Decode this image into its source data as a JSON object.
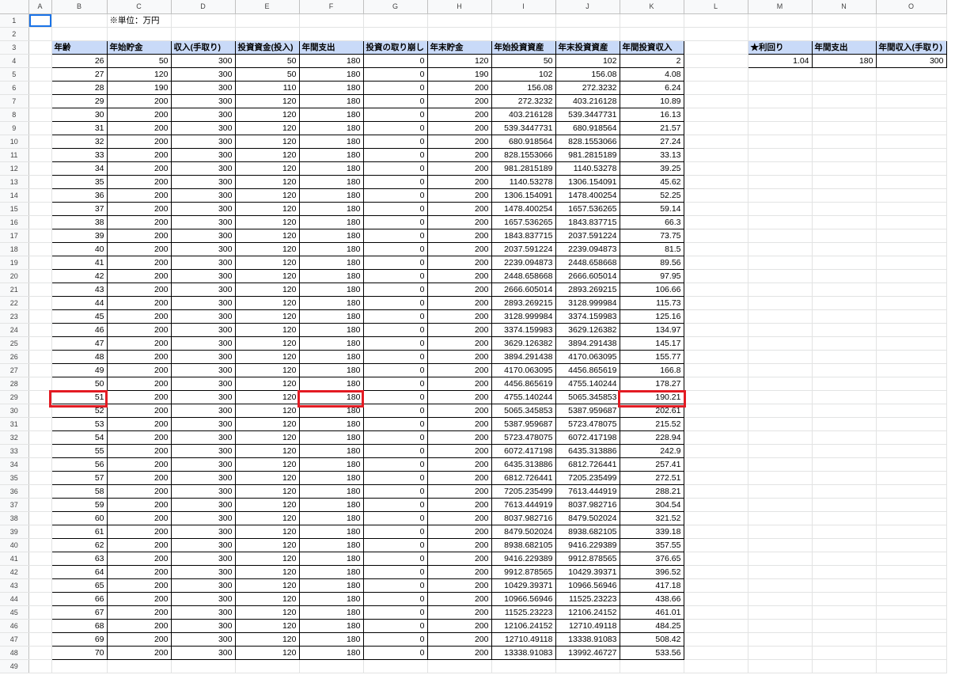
{
  "columns": [
    "",
    "A",
    "B",
    "C",
    "D",
    "E",
    "F",
    "G",
    "H",
    "I",
    "J",
    "K",
    "L",
    "M",
    "N",
    "O"
  ],
  "note": "※単位：万円",
  "headers": [
    "年齢",
    "年始貯金",
    "収入(手取り)",
    "投資資金(投入)",
    "年間支出",
    "投資の取り崩し",
    "年末貯金",
    "年始投資資産",
    "年末投資資産",
    "年間投資収入"
  ],
  "rows": [
    [
      "26",
      "50",
      "300",
      "50",
      "180",
      "0",
      "120",
      "50",
      "102",
      "2"
    ],
    [
      "27",
      "120",
      "300",
      "50",
      "180",
      "0",
      "190",
      "102",
      "156.08",
      "4.08"
    ],
    [
      "28",
      "190",
      "300",
      "110",
      "180",
      "0",
      "200",
      "156.08",
      "272.3232",
      "6.24"
    ],
    [
      "29",
      "200",
      "300",
      "120",
      "180",
      "0",
      "200",
      "272.3232",
      "403.216128",
      "10.89"
    ],
    [
      "30",
      "200",
      "300",
      "120",
      "180",
      "0",
      "200",
      "403.216128",
      "539.3447731",
      "16.13"
    ],
    [
      "31",
      "200",
      "300",
      "120",
      "180",
      "0",
      "200",
      "539.3447731",
      "680.918564",
      "21.57"
    ],
    [
      "32",
      "200",
      "300",
      "120",
      "180",
      "0",
      "200",
      "680.918564",
      "828.1553066",
      "27.24"
    ],
    [
      "33",
      "200",
      "300",
      "120",
      "180",
      "0",
      "200",
      "828.1553066",
      "981.2815189",
      "33.13"
    ],
    [
      "34",
      "200",
      "300",
      "120",
      "180",
      "0",
      "200",
      "981.2815189",
      "1140.53278",
      "39.25"
    ],
    [
      "35",
      "200",
      "300",
      "120",
      "180",
      "0",
      "200",
      "1140.53278",
      "1306.154091",
      "45.62"
    ],
    [
      "36",
      "200",
      "300",
      "120",
      "180",
      "0",
      "200",
      "1306.154091",
      "1478.400254",
      "52.25"
    ],
    [
      "37",
      "200",
      "300",
      "120",
      "180",
      "0",
      "200",
      "1478.400254",
      "1657.536265",
      "59.14"
    ],
    [
      "38",
      "200",
      "300",
      "120",
      "180",
      "0",
      "200",
      "1657.536265",
      "1843.837715",
      "66.3"
    ],
    [
      "39",
      "200",
      "300",
      "120",
      "180",
      "0",
      "200",
      "1843.837715",
      "2037.591224",
      "73.75"
    ],
    [
      "40",
      "200",
      "300",
      "120",
      "180",
      "0",
      "200",
      "2037.591224",
      "2239.094873",
      "81.5"
    ],
    [
      "41",
      "200",
      "300",
      "120",
      "180",
      "0",
      "200",
      "2239.094873",
      "2448.658668",
      "89.56"
    ],
    [
      "42",
      "200",
      "300",
      "120",
      "180",
      "0",
      "200",
      "2448.658668",
      "2666.605014",
      "97.95"
    ],
    [
      "43",
      "200",
      "300",
      "120",
      "180",
      "0",
      "200",
      "2666.605014",
      "2893.269215",
      "106.66"
    ],
    [
      "44",
      "200",
      "300",
      "120",
      "180",
      "0",
      "200",
      "2893.269215",
      "3128.999984",
      "115.73"
    ],
    [
      "45",
      "200",
      "300",
      "120",
      "180",
      "0",
      "200",
      "3128.999984",
      "3374.159983",
      "125.16"
    ],
    [
      "46",
      "200",
      "300",
      "120",
      "180",
      "0",
      "200",
      "3374.159983",
      "3629.126382",
      "134.97"
    ],
    [
      "47",
      "200",
      "300",
      "120",
      "180",
      "0",
      "200",
      "3629.126382",
      "3894.291438",
      "145.17"
    ],
    [
      "48",
      "200",
      "300",
      "120",
      "180",
      "0",
      "200",
      "3894.291438",
      "4170.063095",
      "155.77"
    ],
    [
      "49",
      "200",
      "300",
      "120",
      "180",
      "0",
      "200",
      "4170.063095",
      "4456.865619",
      "166.8"
    ],
    [
      "50",
      "200",
      "300",
      "120",
      "180",
      "0",
      "200",
      "4456.865619",
      "4755.140244",
      "178.27"
    ],
    [
      "51",
      "200",
      "300",
      "120",
      "180",
      "0",
      "200",
      "4755.140244",
      "5065.345853",
      "190.21"
    ],
    [
      "52",
      "200",
      "300",
      "120",
      "180",
      "0",
      "200",
      "5065.345853",
      "5387.959687",
      "202.61"
    ],
    [
      "53",
      "200",
      "300",
      "120",
      "180",
      "0",
      "200",
      "5387.959687",
      "5723.478075",
      "215.52"
    ],
    [
      "54",
      "200",
      "300",
      "120",
      "180",
      "0",
      "200",
      "5723.478075",
      "6072.417198",
      "228.94"
    ],
    [
      "55",
      "200",
      "300",
      "120",
      "180",
      "0",
      "200",
      "6072.417198",
      "6435.313886",
      "242.9"
    ],
    [
      "56",
      "200",
      "300",
      "120",
      "180",
      "0",
      "200",
      "6435.313886",
      "6812.726441",
      "257.41"
    ],
    [
      "57",
      "200",
      "300",
      "120",
      "180",
      "0",
      "200",
      "6812.726441",
      "7205.235499",
      "272.51"
    ],
    [
      "58",
      "200",
      "300",
      "120",
      "180",
      "0",
      "200",
      "7205.235499",
      "7613.444919",
      "288.21"
    ],
    [
      "59",
      "200",
      "300",
      "120",
      "180",
      "0",
      "200",
      "7613.444919",
      "8037.982716",
      "304.54"
    ],
    [
      "60",
      "200",
      "300",
      "120",
      "180",
      "0",
      "200",
      "8037.982716",
      "8479.502024",
      "321.52"
    ],
    [
      "61",
      "200",
      "300",
      "120",
      "180",
      "0",
      "200",
      "8479.502024",
      "8938.682105",
      "339.18"
    ],
    [
      "62",
      "200",
      "300",
      "120",
      "180",
      "0",
      "200",
      "8938.682105",
      "9416.229389",
      "357.55"
    ],
    [
      "63",
      "200",
      "300",
      "120",
      "180",
      "0",
      "200",
      "9416.229389",
      "9912.878565",
      "376.65"
    ],
    [
      "64",
      "200",
      "300",
      "120",
      "180",
      "0",
      "200",
      "9912.878565",
      "10429.39371",
      "396.52"
    ],
    [
      "65",
      "200",
      "300",
      "120",
      "180",
      "0",
      "200",
      "10429.39371",
      "10966.56946",
      "417.18"
    ],
    [
      "66",
      "200",
      "300",
      "120",
      "180",
      "0",
      "200",
      "10966.56946",
      "11525.23223",
      "438.66"
    ],
    [
      "67",
      "200",
      "300",
      "120",
      "180",
      "0",
      "200",
      "11525.23223",
      "12106.24152",
      "461.01"
    ],
    [
      "68",
      "200",
      "300",
      "120",
      "180",
      "0",
      "200",
      "12106.24152",
      "12710.49118",
      "484.25"
    ],
    [
      "69",
      "200",
      "300",
      "120",
      "180",
      "0",
      "200",
      "12710.49118",
      "13338.91083",
      "508.42"
    ],
    [
      "70",
      "200",
      "300",
      "120",
      "180",
      "0",
      "200",
      "13338.91083",
      "13992.46727",
      "533.56"
    ]
  ],
  "params": {
    "headers": [
      "★利回り",
      "年間支出",
      "年間収入(手取り)"
    ],
    "values": [
      "1.04",
      "180",
      "300"
    ]
  },
  "highlight_color": "#e31b23"
}
